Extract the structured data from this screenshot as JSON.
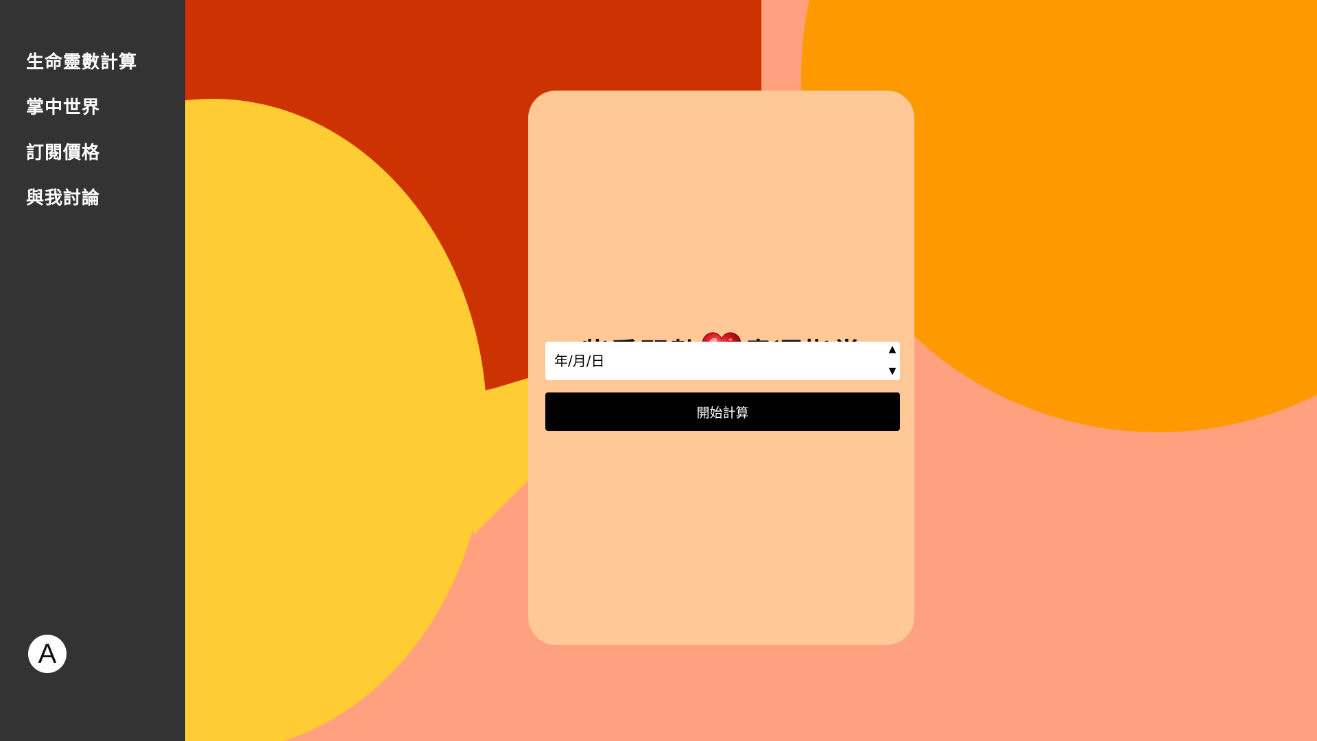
{
  "sidebar": {
    "items": [
      {
        "label": "生命靈數計算"
      },
      {
        "label": "掌中世界"
      },
      {
        "label": "訂閱價格"
      },
      {
        "label": "與我討論"
      }
    ],
    "avatar_letter": "A"
  },
  "card": {
    "title_left": "紫喬問數",
    "title_right": "盡運指掌",
    "date_input": {
      "value": "年/月/日"
    },
    "submit_label": "開始計算"
  },
  "colors": {
    "sidebar": "#333333",
    "background": "#ffa07f",
    "shape_red": "#cc3300",
    "shape_orange": "#ff9900",
    "shape_yellow": "#ffcc33",
    "card": "#ffc896",
    "button": "#000000"
  },
  "icons": {
    "heart": "heart-icon",
    "stepper_up": "triangle-up-icon",
    "stepper_down": "triangle-down-icon"
  }
}
